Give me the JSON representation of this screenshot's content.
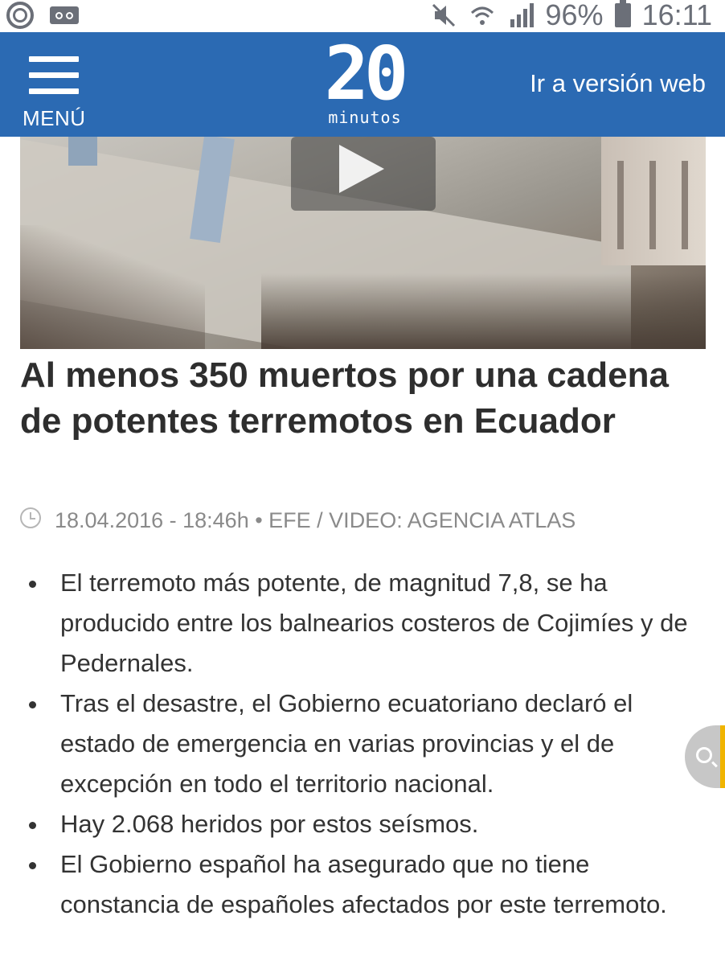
{
  "status_bar": {
    "battery": "96%",
    "time": "16:11",
    "icons": [
      "ring-notification-icon",
      "voicemail-icon",
      "mute-icon",
      "wifi-icon",
      "signal-icon",
      "battery-icon"
    ]
  },
  "header": {
    "menu_label": "MENÚ",
    "logo_number": "20",
    "logo_word": "minutos",
    "web_link": "Ir a versión web",
    "background_color": "#2b6ab3"
  },
  "video": {
    "play_icon": "play-icon"
  },
  "article": {
    "headline": "Al menos 350 muertos por una cadena de potentes terremotos en Ecuador",
    "meta": "18.04.2016 - 18:46h • EFE / VIDEO: AGENCIA ATLAS",
    "bullets": [
      "El terremoto más potente, de magnitud 7,8, se ha producido entre los balnearios costeros de Cojimíes y de Pedernales.",
      "Tras el desastre, el Gobierno ecuatoriano declaró el estado de emergencia en varias provincias y el de excepción en todo el territorio nacional.",
      "Hay 2.068 heridos por estos seísmos.",
      "El Gobierno español ha asegurado que no tiene constancia de españoles afectados por este terremoto."
    ]
  },
  "floating": {
    "search_icon": "search-icon",
    "accent_color": "#f0b400"
  }
}
